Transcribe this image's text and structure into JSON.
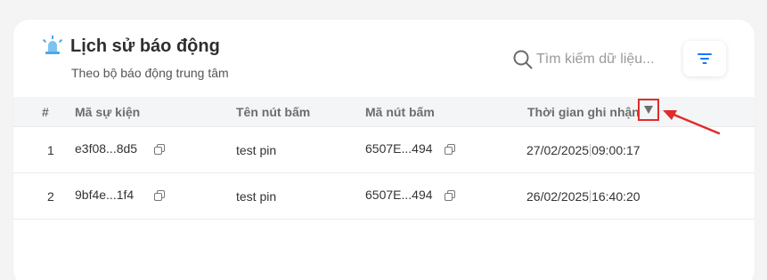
{
  "header": {
    "title": "Lịch sử báo động",
    "subtitle": "Theo bộ báo động trung tâm",
    "icon": "siren-icon"
  },
  "search": {
    "placeholder": "Tìm kiếm dữ liệu..."
  },
  "filter_button": {
    "icon": "filter-lines-icon"
  },
  "table": {
    "columns": [
      "#",
      "Mã sự kiện",
      "Tên nút bấm",
      "Mã nút bấm",
      "Thời gian ghi nhận"
    ],
    "rows": [
      {
        "index": "1",
        "event_id": "e3f08...8d5",
        "button_name": "test pin",
        "button_id": "6507E...494",
        "date": "27/02/2025",
        "time": "09:00:17"
      },
      {
        "index": "2",
        "event_id": "9bf4e...1f4",
        "button_name": "test pin",
        "button_id": "6507E...494",
        "date": "26/02/2025",
        "time": "16:40:20"
      }
    ]
  },
  "colors": {
    "accent": "#1677ff",
    "highlight": "#e12b2b",
    "icon_blue": "#4aa8e8"
  }
}
